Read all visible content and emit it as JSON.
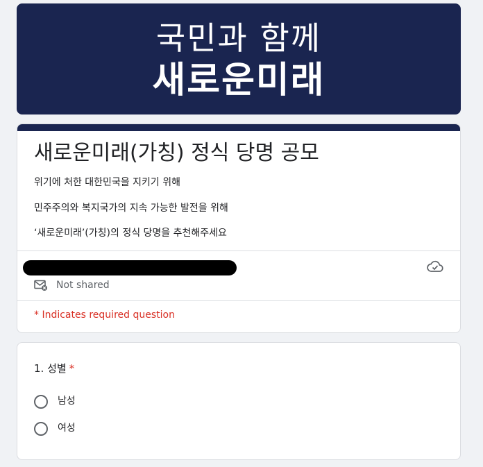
{
  "banner": {
    "line1": "국민과 함께",
    "line2": "새로운미래",
    "color": "#1a2550"
  },
  "form": {
    "title": "새로운미래(가칭) 정식 당명 공모",
    "description": [
      "위기에 처한 대한민국을 지키기 위해",
      "민주주의와 복지국가의 지속 가능한 발전을 위해",
      "‘새로운미래’(가칭)의 정식 당명을 추천해주세요"
    ],
    "account": {
      "not_shared": "Not shared",
      "not_shared_icon": "mail-off-icon",
      "cloud_icon": "cloud-saved-icon"
    },
    "required_note": "* Indicates required question",
    "required_color": "#d93025"
  },
  "question1": {
    "title": "1. 성별",
    "required_mark": "*",
    "options": [
      "남성",
      "여성"
    ]
  }
}
